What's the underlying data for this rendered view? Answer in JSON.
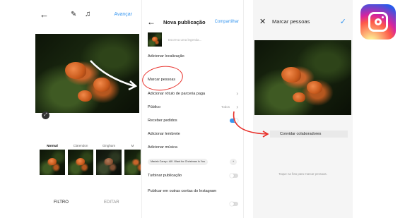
{
  "panel1": {
    "next_label": "Avançar",
    "filters": [
      {
        "name": "Normal",
        "active": true
      },
      {
        "name": "Clarendon",
        "active": false
      },
      {
        "name": "Gingham",
        "active": false
      },
      {
        "name": "M",
        "active": false
      }
    ],
    "tabs": {
      "filter": "FILTRO",
      "edit": "EDITAR"
    }
  },
  "panel2": {
    "title": "Nova publicação",
    "share_label": "Compartilhar",
    "caption_placeholder": "Escreva uma legenda...",
    "rows": {
      "add_location": "Adicionar localização",
      "tag_people": "Marcar pessoas",
      "paid_partnership": "Adicionar rótulo de parceria paga",
      "audience": "Público",
      "audience_value": "Todos",
      "receive_orders": "Receber pedidos",
      "add_reminder": "Adicionar lembrete",
      "add_music": "Adicionar música",
      "boost_post": "Turbinar publicação",
      "publish_other": "Publicar em outras contas do Instagram"
    },
    "music_chips": [
      "Mariah Carey • All I Want for Christmas Is You",
      "+"
    ]
  },
  "panel3": {
    "title": "Marcar pessoas",
    "invite_label": "Convidar colaboradores",
    "hint": "Toque na foto para marcar pessoas."
  },
  "colors": {
    "accent": "#3897f0",
    "annotation": "#e8302a"
  }
}
